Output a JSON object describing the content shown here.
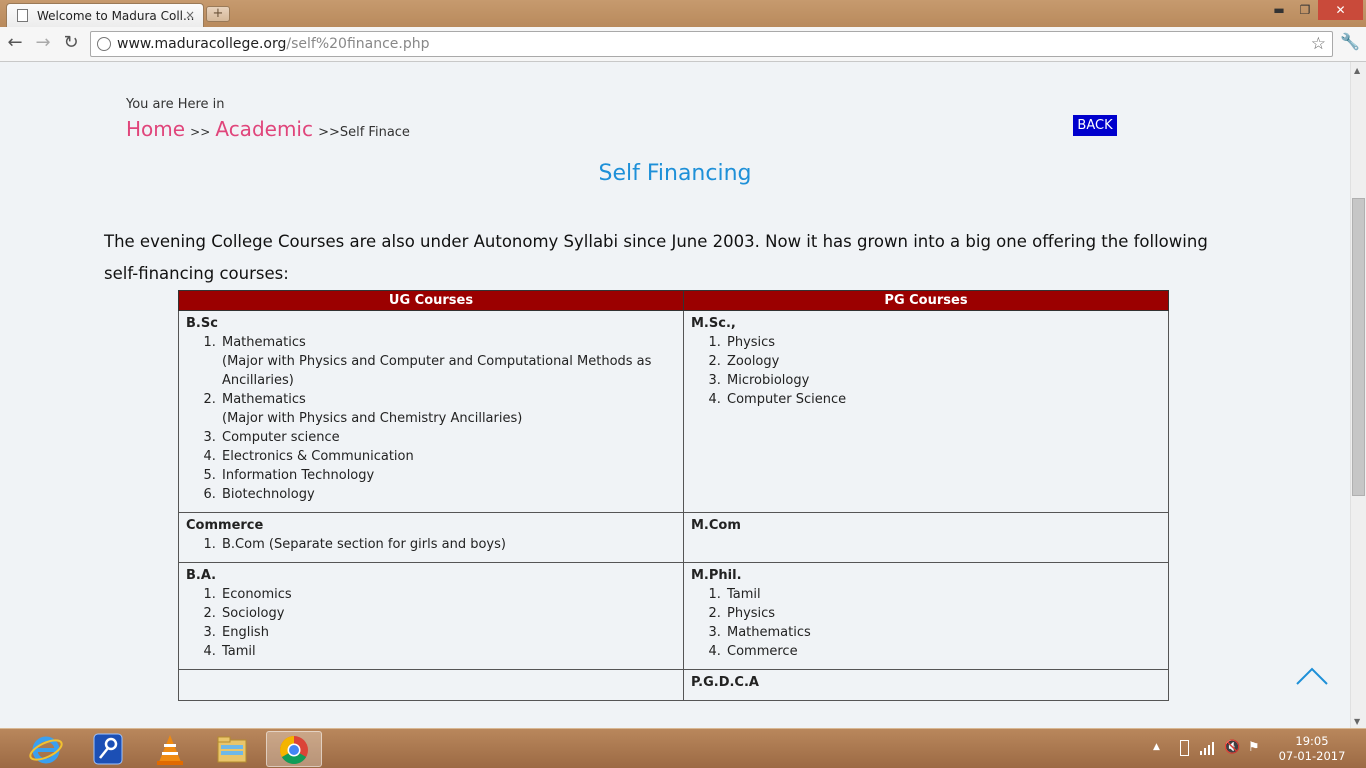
{
  "browser": {
    "tab_title": "Welcome to Madura Coll...",
    "tab_close": "×",
    "new_tab": "+",
    "url_host": "www.maduracollege.org",
    "url_path": "/self%20finance.php",
    "win_min": "▬",
    "win_max": "❐",
    "win_close": "✕",
    "back": "←",
    "forward": "→",
    "reload": "↻",
    "star": "☆",
    "wrench": "🔧"
  },
  "breadcrumb": {
    "intro": "You are Here in",
    "home": "Home",
    "sep1": ">>",
    "academic": "Academic",
    "current": ">>Self Finace"
  },
  "back_button": "BACK",
  "page_title": "Self Financing",
  "intro_text": "The evening College Courses are also under Autonomy Syllabi since June 2003. Now it has grown into a big one offering the following self-financing courses:",
  "table": {
    "headers": [
      "UG Courses",
      "PG Courses"
    ],
    "rows": [
      {
        "ug": {
          "group": "B.Sc",
          "items": [
            {
              "name": "Mathematics",
              "note": "(Major with Physics and Computer and Computational Methods as Ancillaries)"
            },
            {
              "name": "Mathematics",
              "note": "(Major with Physics and Chemistry Ancillaries)"
            },
            {
              "name": "Computer science"
            },
            {
              "name": "Electronics & Communication"
            },
            {
              "name": "Information Technology"
            },
            {
              "name": "Biotechnology"
            }
          ]
        },
        "pg": {
          "group": "M.Sc.,",
          "items": [
            {
              "name": "Physics"
            },
            {
              "name": "Zoology"
            },
            {
              "name": "Microbiology"
            },
            {
              "name": "Computer Science"
            }
          ]
        }
      },
      {
        "ug": {
          "group": "Commerce",
          "items": [
            {
              "name": "B.Com (Separate section for girls and boys)"
            }
          ]
        },
        "pg": {
          "group": "M.Com",
          "items": []
        }
      },
      {
        "ug": {
          "group": "B.A.",
          "items": [
            {
              "name": "Economics"
            },
            {
              "name": "Sociology"
            },
            {
              "name": "English"
            },
            {
              "name": "Tamil"
            }
          ]
        },
        "pg": {
          "group": "M.Phil.",
          "items": [
            {
              "name": "Tamil"
            },
            {
              "name": "Physics"
            },
            {
              "name": "Mathematics"
            },
            {
              "name": "Commerce"
            }
          ]
        }
      },
      {
        "ug": {
          "group": "",
          "items": []
        },
        "pg": {
          "group": "P.G.D.C.A",
          "items": []
        }
      }
    ]
  },
  "taskbar": {
    "apps": [
      "internet-explorer-icon",
      "keys-icon",
      "vlc-icon",
      "folder-icon",
      "chrome-icon"
    ],
    "time": "19:05",
    "date": "07-01-2017"
  },
  "colors": {
    "link": "#e0457b",
    "title": "#1e90d8",
    "table_header": "#9b0000",
    "back_button": "#0000cd"
  }
}
